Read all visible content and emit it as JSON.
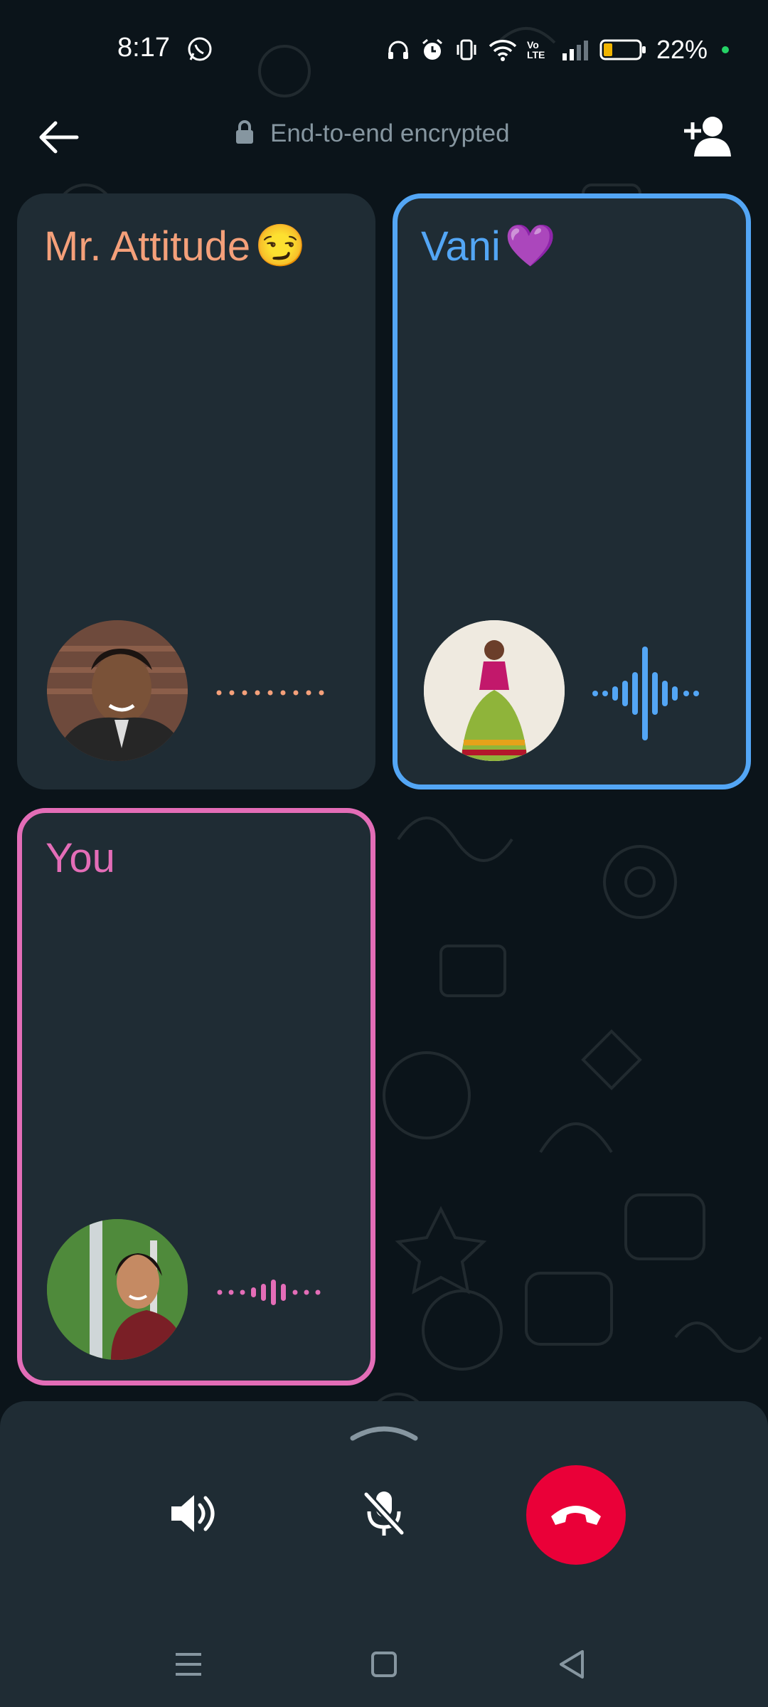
{
  "status_bar": {
    "time": "8:17",
    "battery": "22%",
    "network_label": "Vo LTE",
    "icons": [
      "whatsapp-icon",
      "headphones-icon",
      "alarm-icon",
      "vibrate-icon",
      "wifi-icon",
      "volte-icon",
      "signal-icon",
      "battery-icon"
    ]
  },
  "header": {
    "encryption_text": "End-to-end encrypted",
    "icons": [
      "back-arrow-icon",
      "lock-icon",
      "add-person-icon"
    ]
  },
  "participants": [
    {
      "name": "Mr. Attitude",
      "emoji": "😏",
      "name_color": "#f4a07a",
      "wave_color": "#f4a07a",
      "speaking": false
    },
    {
      "name": "Vani",
      "emoji": "💜",
      "name_color": "#53a6f5",
      "wave_color": "#53a6f5",
      "border_color": "#53a6f5",
      "speaking": true
    },
    {
      "name": "You",
      "emoji": "",
      "name_color": "#e36db7",
      "wave_color": "#e36db7",
      "border_color": "#e36db7",
      "speaking": false
    }
  ],
  "controls": {
    "icons": [
      "speaker-icon",
      "mic-off-icon",
      "end-call-icon"
    ],
    "end_call_color": "#ea0038"
  },
  "navigation": {
    "icons": [
      "menu-icon",
      "home-icon",
      "back-icon"
    ]
  },
  "colors": {
    "background": "#0b141a",
    "tile_bg": "#1f2c34",
    "online_dot": "#25d366"
  }
}
